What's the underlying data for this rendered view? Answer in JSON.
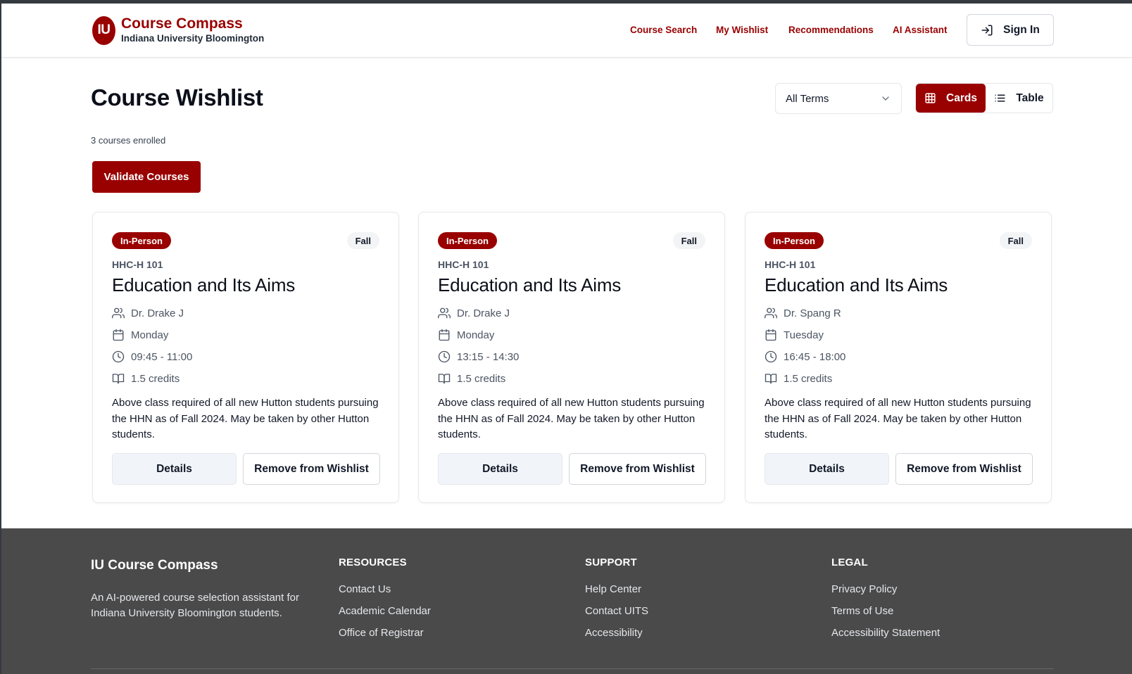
{
  "header": {
    "logo_text": "IU",
    "title": "Course Compass",
    "subtitle": "Indiana University Bloomington",
    "nav": [
      {
        "label": "Course Search"
      },
      {
        "label": "My Wishlist"
      },
      {
        "label": "Recommendations"
      },
      {
        "label": "AI Assistant"
      }
    ],
    "sign_in_label": "Sign In"
  },
  "page": {
    "title": "Course Wishlist",
    "term_filter": "All Terms",
    "view_cards_label": "Cards",
    "view_table_label": "Table",
    "count_text": "3 courses enrolled",
    "validate_label": "Validate Courses"
  },
  "cards": [
    {
      "format": "In-Person",
      "term": "Fall",
      "code": "HHC-H 101",
      "title": "Education and Its Aims",
      "instructor": "Dr. Drake J",
      "day": "Monday",
      "time": "09:45 - 11:00",
      "credits": "1.5 credits",
      "description": "Above class required of all new Hutton students pursuing the HHN as of Fall 2024. May be taken by other Hutton students.",
      "details_label": "Details",
      "remove_label": "Remove from Wishlist"
    },
    {
      "format": "In-Person",
      "term": "Fall",
      "code": "HHC-H 101",
      "title": "Education and Its Aims",
      "instructor": "Dr. Drake J",
      "day": "Monday",
      "time": "13:15 - 14:30",
      "credits": "1.5 credits",
      "description": "Above class required of all new Hutton students pursuing the HHN as of Fall 2024. May be taken by other Hutton students.",
      "details_label": "Details",
      "remove_label": "Remove from Wishlist"
    },
    {
      "format": "In-Person",
      "term": "Fall",
      "code": "HHC-H 101",
      "title": "Education and Its Aims",
      "instructor": "Dr. Spang R",
      "day": "Tuesday",
      "time": "16:45 - 18:00",
      "credits": "1.5 credits",
      "description": "Above class required of all new Hutton students pursuing the HHN as of Fall 2024. May be taken by other Hutton students.",
      "details_label": "Details",
      "remove_label": "Remove from Wishlist"
    }
  ],
  "footer": {
    "brand": "IU Course Compass",
    "description": "An AI-powered course selection assistant for Indiana University Bloomington students.",
    "columns": [
      {
        "heading": "RESOURCES",
        "links": [
          "Contact Us",
          "Academic Calendar",
          "Office of Registrar"
        ]
      },
      {
        "heading": "SUPPORT",
        "links": [
          "Help Center",
          "Contact UITS",
          "Accessibility"
        ]
      },
      {
        "heading": "LEGAL",
        "links": [
          "Privacy Policy",
          "Terms of Use",
          "Accessibility Statement"
        ]
      }
    ]
  },
  "colors": {
    "brand": "#990000",
    "footer_bg": "#4a4a4a"
  },
  "icons": {
    "sign_in": "sign-in-icon",
    "dropdown": "chevron-down-icon",
    "cards_view": "grid-icon",
    "table_view": "list-icon",
    "instructor": "users-icon",
    "day": "calendar-icon",
    "time": "clock-icon",
    "credits": "book-icon"
  }
}
